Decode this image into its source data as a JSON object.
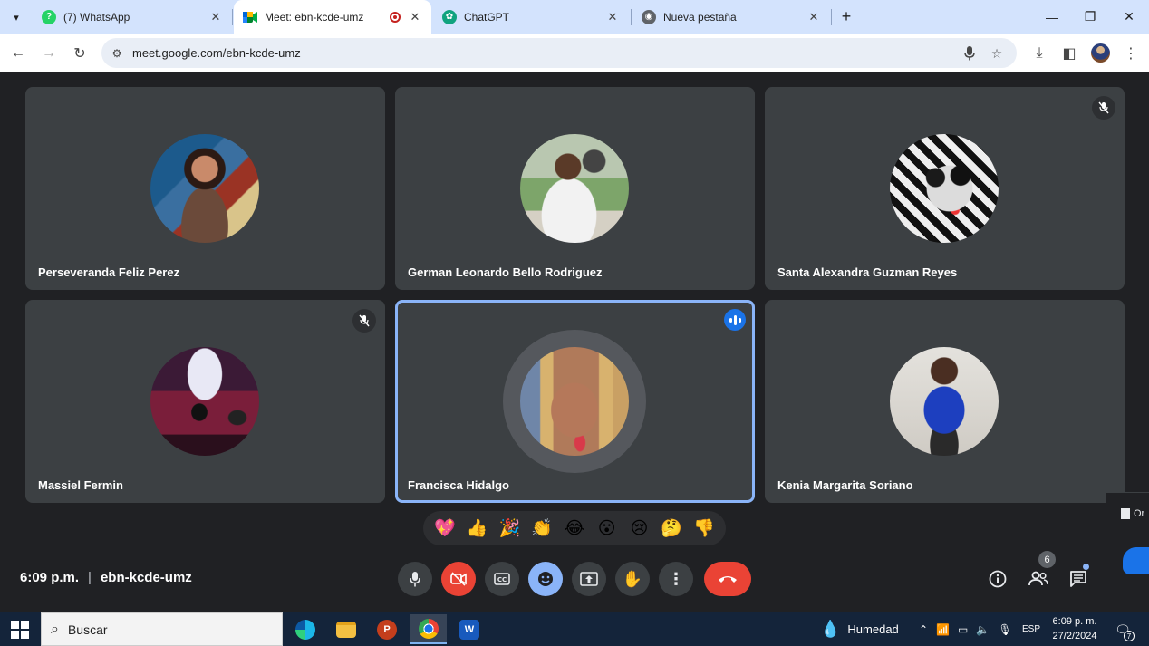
{
  "browser": {
    "tabs": [
      {
        "title": "(7) WhatsApp",
        "icon": "whatsapp-icon",
        "color": "#25d366"
      },
      {
        "title": "Meet: ebn-kcde-umz",
        "icon": "google-meet-icon",
        "active": true,
        "recording": true
      },
      {
        "title": "ChatGPT",
        "icon": "chatgpt-icon",
        "color": "#10a37f"
      },
      {
        "title": "Nueva pestaña",
        "icon": "chrome-icon"
      }
    ],
    "url": "meet.google.com/ebn-kcde-umz"
  },
  "meet": {
    "participants": [
      {
        "name": "Perseveranda Feliz Perez",
        "muted": false
      },
      {
        "name": "German Leonardo Bello Rodriguez",
        "muted": false
      },
      {
        "name": "Santa Alexandra Guzman Reyes",
        "muted": true
      },
      {
        "name": "Massiel Fermin",
        "muted": true
      },
      {
        "name": "Francisca Hidalgo",
        "speaking": true
      },
      {
        "name": "Kenia Margarita Soriano",
        "muted": false
      }
    ],
    "reactions": [
      "💖",
      "👍",
      "🎉",
      "👏",
      "😂",
      "😮",
      "😢",
      "🤔",
      "👎"
    ],
    "time": "6:09 p.m.",
    "separator": "|",
    "meeting_code": "ebn-kcde-umz",
    "participant_count": "6",
    "accent": "#8ab4f8",
    "leave_color": "#ea4335"
  },
  "popup": {
    "text": "Or"
  },
  "taskbar": {
    "search_placeholder": "Buscar",
    "weather": "Humedad",
    "language": "ESP",
    "time": "6:09 p. m.",
    "date": "27/2/2024",
    "notifications": "7"
  }
}
